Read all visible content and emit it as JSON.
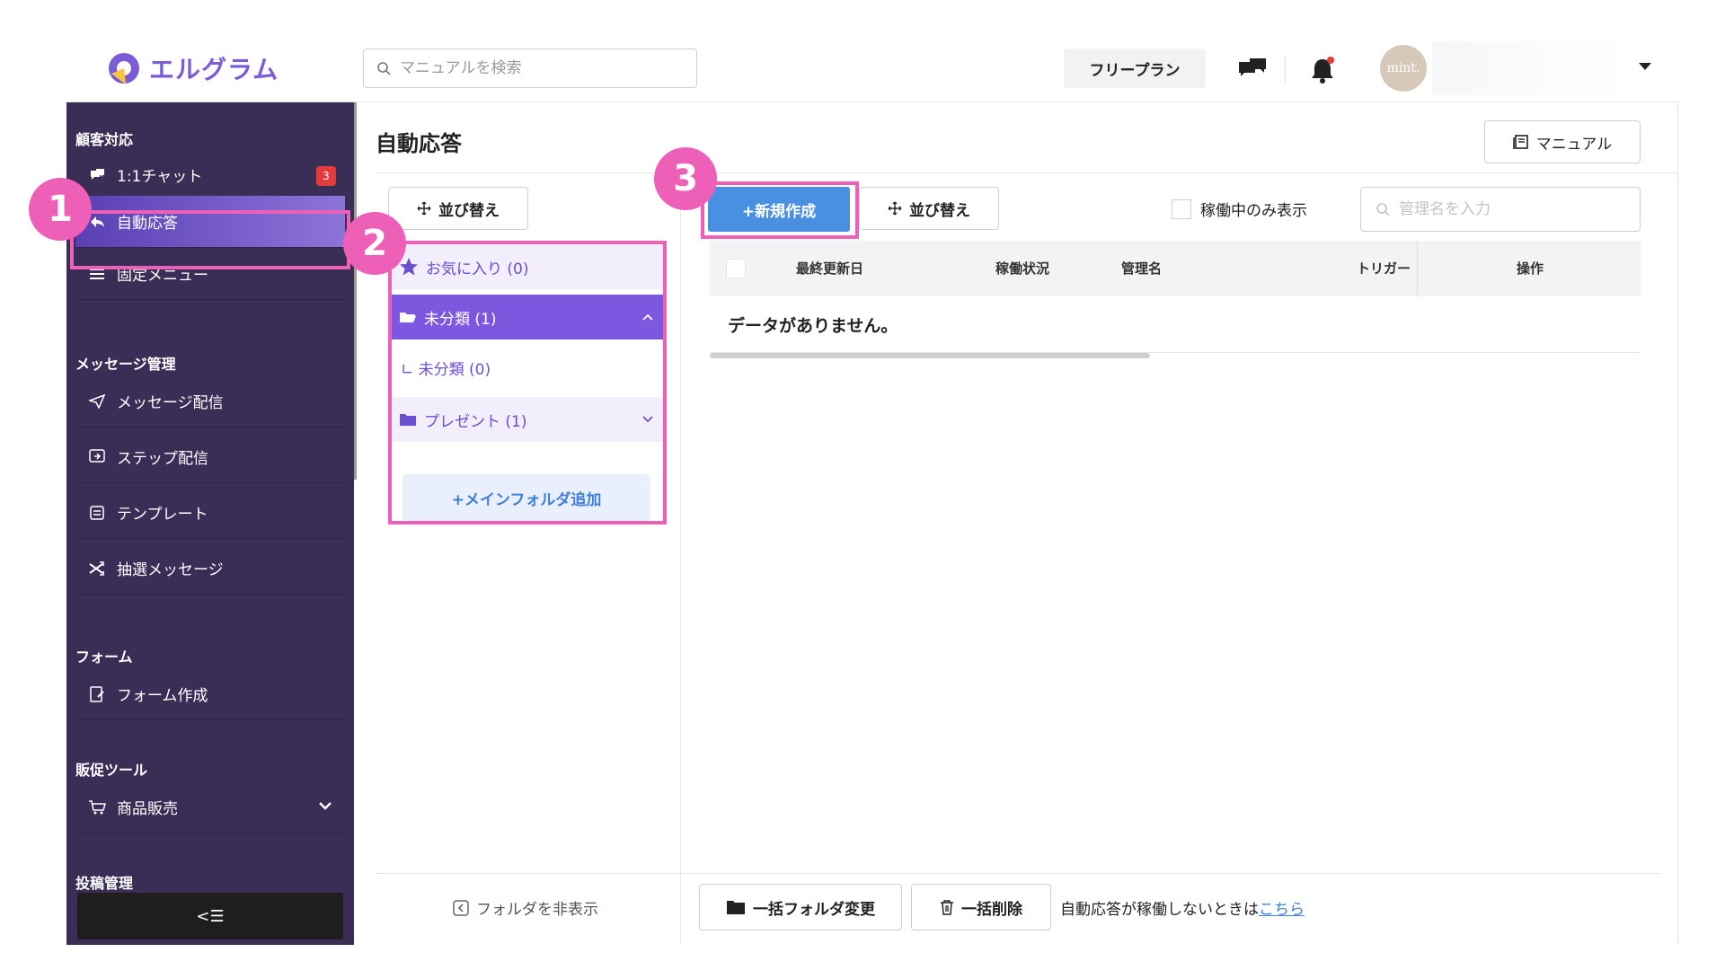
{
  "header": {
    "app_name": "エルグラム",
    "search_placeholder": "マニュアルを検索",
    "plan_label": "フリープラン",
    "avatar_text": "mint."
  },
  "sidebar": {
    "sections": [
      {
        "title": "顧客対応",
        "items": [
          {
            "label": "1:1チャット",
            "icon": "chat-icon",
            "badge": "3"
          },
          {
            "label": "自動応答",
            "icon": "reply-icon",
            "active": true
          },
          {
            "label": "固定メニュー",
            "icon": "menu-icon"
          }
        ]
      },
      {
        "title": "メッセージ管理",
        "items": [
          {
            "label": "メッセージ配信",
            "icon": "send-icon"
          },
          {
            "label": "ステップ配信",
            "icon": "step-icon"
          },
          {
            "label": "テンプレート",
            "icon": "template-icon"
          },
          {
            "label": "抽選メッセージ",
            "icon": "shuffle-icon"
          }
        ]
      },
      {
        "title": "フォーム",
        "items": [
          {
            "label": "フォーム作成",
            "icon": "form-icon"
          }
        ]
      },
      {
        "title": "販促ツール",
        "items": [
          {
            "label": "商品販売",
            "icon": "cart-icon"
          }
        ]
      },
      {
        "title": "投稿管理",
        "items": []
      }
    ],
    "collapse_label": "<☰"
  },
  "main": {
    "title": "自動応答",
    "manual_button": "マニュアル",
    "sort_label": "並び替え",
    "new_button": "+新規作成",
    "active_only_label": "稼働中のみ表示",
    "name_search_placeholder": "管理名を入力",
    "table": {
      "columns": [
        "最終更新日",
        "稼働状況",
        "管理名",
        "トリガー",
        "操作"
      ],
      "empty_text": "データがありません。"
    },
    "folders": {
      "favorites": "お気に入り (0)",
      "uncategorized": "未分類 (1)",
      "sub_uncategorized": "∟ 未分類 (0)",
      "present": "プレゼント (1)",
      "add_main_folder": "+メインフォルダ追加"
    },
    "footer": {
      "hide_folder": "フォルダを非表示",
      "bulk_folder_change": "一括フォルダ変更",
      "bulk_delete": "一括削除",
      "note_text": "自動応答が稼働しないときは",
      "note_link": "こちら"
    }
  },
  "callouts": [
    "1",
    "2",
    "3"
  ],
  "colors": {
    "sidebar_bg": "#3a2e57",
    "active_gradient_start": "#5a3fb3",
    "highlight_pink": "#ee5fb7",
    "primary_blue": "#4a90e2",
    "folder_purple": "#7e57e0",
    "badge_red": "#e53b3b"
  }
}
